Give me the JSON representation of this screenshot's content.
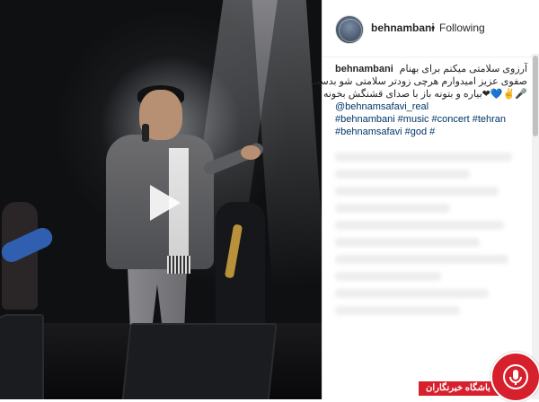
{
  "post": {
    "username": "behnambani",
    "separator": "•",
    "follow_label": "Following"
  },
  "caption": {
    "user": "behnambani",
    "line1": "آرزوی سلامتی میکنم برای بهنام",
    "line2": "صفوی عزیز امیدوارم هرچی زودتر سلامتی شو بدست",
    "line3": "🎤✌💙❤بیاره و بتونه باز با صدای قشنگش بخونه",
    "mention": "@behnamsafavi_real",
    "tags_line1": [
      "#behnambani",
      "#music",
      "#concert",
      "#tehran"
    ],
    "tags_line2": [
      "#behnamsafavi",
      "#god",
      "#"
    ]
  },
  "media": {
    "type": "video",
    "play_icon": "play-icon"
  },
  "watermark": {
    "text": "باشگاه خبرنگاران",
    "color": "#d6212d"
  },
  "colors": {
    "link": "#003569",
    "text": "#262626"
  }
}
